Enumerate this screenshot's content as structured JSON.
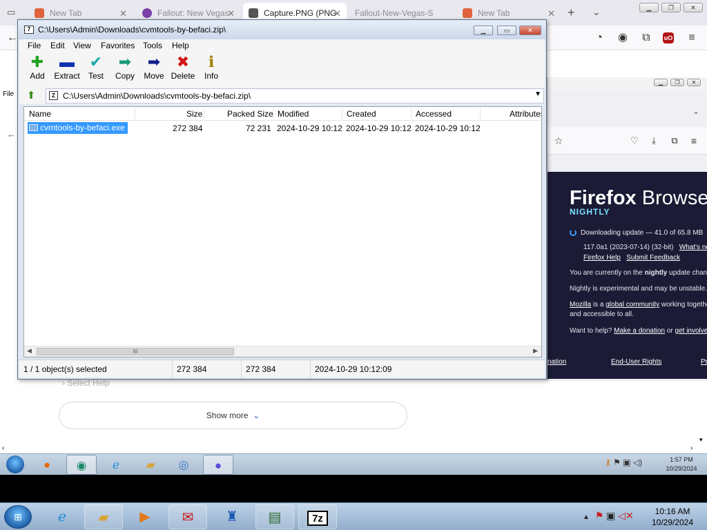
{
  "browser": {
    "tabs": [
      {
        "title": "New Tab",
        "fav_color": "#e0633d"
      },
      {
        "title": "Fallout: New Vegas",
        "fav_color": "#7b3fa8"
      },
      {
        "title": "Capture.PNG (PNG",
        "fav_color": "#555555"
      },
      {
        "title": "Fallout-New-Vegas-S",
        "fav_color": "#cccccc"
      },
      {
        "title": "New Tab",
        "fav_color": "#e0633d"
      }
    ],
    "ublock_label": "uO"
  },
  "about": {
    "brand_light": "Firefox",
    "brand_rest": " Browser",
    "channel": "NIGHTLY",
    "downloading": "Downloading update — 41.0 of 65.8 MB",
    "version": "117.0a1 (2023-07-14) (32-bit)",
    "whats_new": "What's new",
    "firefox_help": "Firefox Help",
    "submit_feedback": "Submit Feedback",
    "channel_note_pre": "You are currently on the ",
    "channel_note_bold": "nightly",
    "channel_note_post": " update channe",
    "experimental": "Nightly is experimental and may be unstable.",
    "mozilla": "Mozilla",
    "is_a": " is a ",
    "global_community": "global community",
    "working": " working togethe",
    "accessible": "and accessible to all.",
    "want_help": "Want to help? ",
    "donation": "Make a donation",
    "or": " or ",
    "get_involved": "get involved!",
    "footer_left": "nation",
    "footer_mid": "End-User Rights",
    "footer_right": "Pr"
  },
  "behind": {
    "select_help": "Select Help",
    "show_more": "Show more"
  },
  "sevenzip": {
    "title": "C:\\Users\\Admin\\Downloads\\cvmtools-by-befaci.zip\\",
    "menu": [
      "File",
      "Edit",
      "View",
      "Favorites",
      "Tools",
      "Help"
    ],
    "toolbar": [
      {
        "label": "Add",
        "icon": "plus-icon",
        "glyph": "✚",
        "color": "#1fa31f"
      },
      {
        "label": "Extract",
        "icon": "minus-icon",
        "glyph": "▬",
        "color": "#1030b0"
      },
      {
        "label": "Test",
        "icon": "check-icon",
        "glyph": "✔",
        "color": "#20a8a8"
      },
      {
        "label": "Copy",
        "icon": "copy-arrow-icon",
        "glyph": "➡",
        "color": "#1a9a7a"
      },
      {
        "label": "Move",
        "icon": "move-arrow-icon",
        "glyph": "➡",
        "color": "#10208a"
      },
      {
        "label": "Delete",
        "icon": "delete-x-icon",
        "glyph": "✖",
        "color": "#d01818"
      },
      {
        "label": "Info",
        "icon": "info-icon",
        "glyph": "ℹ",
        "color": "#a08000"
      }
    ],
    "path": "C:\\Users\\Admin\\Downloads\\cvmtools-by-befaci.zip\\",
    "columns": [
      "Name",
      "Size",
      "Packed Size",
      "Modified",
      "Created",
      "Accessed",
      "Attributes"
    ],
    "rows": [
      {
        "name": "cvmtools-by-befaci.exe",
        "size": "272 384",
        "packed": "72 231",
        "modified": "2024-10-29 10:12",
        "created": "2024-10-29 10:12",
        "accessed": "2024-10-29 10:12"
      }
    ],
    "status": {
      "selected": "1 / 1 object(s) selected",
      "size": "272 384",
      "packed": "272 384",
      "date": "2024-10-29 10:12:09"
    },
    "scroll_grip": "III"
  },
  "inner_taskbar": {
    "time": "1:57 PM",
    "date": "10/29/2024"
  },
  "taskbar": {
    "time": "10:16 AM",
    "date": "10/29/2024",
    "sevenzip_label": "7z"
  }
}
